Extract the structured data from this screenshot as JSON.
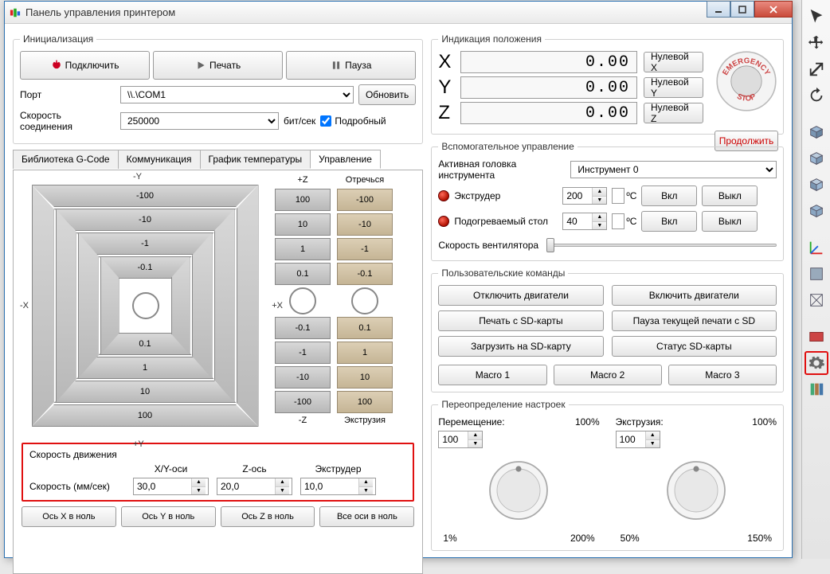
{
  "window": {
    "title": "Панель управления принтером"
  },
  "init": {
    "legend": "Инициализация",
    "connect": "Подключить",
    "print": "Печать",
    "pause": "Пауза",
    "port_label": "Порт",
    "port_value": "\\\\.\\COM1",
    "refresh": "Обновить",
    "baud_label": "Скорость соединения",
    "baud_value": "250000",
    "baud_unit": "бит/сек",
    "verbose": "Подробный"
  },
  "tabs": {
    "gcode": "Библиотека G-Code",
    "comm": "Коммуникация",
    "temp": "График температуры",
    "control": "Управление"
  },
  "jog": {
    "minusY": "-Y",
    "plusY": "+Y",
    "minusX": "-X",
    "plusX": "+X",
    "plusZ": "+Z",
    "minusZ": "-Z",
    "retract": "Отречься",
    "extrude": "Экструзия",
    "v100n": "-100",
    "v10n": "-10",
    "v1n": "-1",
    "v01n": "-0.1",
    "v01": "0.1",
    "v1": "1",
    "v10": "10",
    "v100": "100",
    "z100": "100",
    "z10": "10",
    "z1": "1",
    "z01": "0.1",
    "zn01": "-0.1",
    "zn1": "-1",
    "zn10": "-10",
    "zn100": "-100",
    "e100n": "-100",
    "e10n": "-10",
    "e1n": "-1",
    "e01n": "-0.1",
    "e01": "0.1",
    "e1": "1",
    "e10": "10",
    "e100": "100"
  },
  "speed": {
    "legend": "Скорость движения",
    "xy": "X/Y-оси",
    "z": "Z-ось",
    "e": "Экструдер",
    "label": "Скорость (мм/сек)",
    "xy_val": "30,0",
    "z_val": "20,0",
    "e_val": "10,0"
  },
  "home": {
    "x": "Ось X в ноль",
    "y": "Ось Y в ноль",
    "z": "Ось Z в ноль",
    "all": "Все оси в ноль"
  },
  "pos": {
    "legend": "Индикация положения",
    "x": "X",
    "y": "Y",
    "z": "Z",
    "x_val": "0.00",
    "y_val": "0.00",
    "z_val": "0.00",
    "zero_x": "Нулевой X",
    "zero_y": "Нулевой Y",
    "zero_z": "Нулевой Z",
    "continue": "Продолжить"
  },
  "aux": {
    "legend": "Вспомогательное управление",
    "head_label": "Активная головка инструмента",
    "head_value": "Инструмент 0",
    "extruder": "Экструдер",
    "bed": "Подогреваемый стол",
    "ext_val": "200",
    "bed_val": "40",
    "degC": "ºC",
    "on": "Вкл",
    "off": "Выкл",
    "fan": "Скорость вентилятора"
  },
  "cmds": {
    "legend": "Пользовательские команды",
    "motors_off": "Отключить двигатели",
    "motors_on": "Включить двигатели",
    "sd_print": "Печать с SD-карты",
    "sd_pause": "Пауза текущей печати с SD",
    "sd_upload": "Загрузить на SD-карту",
    "sd_status": "Статус SD-карты",
    "m1": "Macro 1",
    "m2": "Macro 2",
    "m3": "Macro 3"
  },
  "ovr": {
    "legend": "Переопределение настроек",
    "move": "Перемещение:",
    "extr": "Экструзия:",
    "pct": "100%",
    "val": "100",
    "lo1": "1%",
    "hi1": "200%",
    "lo2": "50%",
    "hi2": "150%"
  }
}
